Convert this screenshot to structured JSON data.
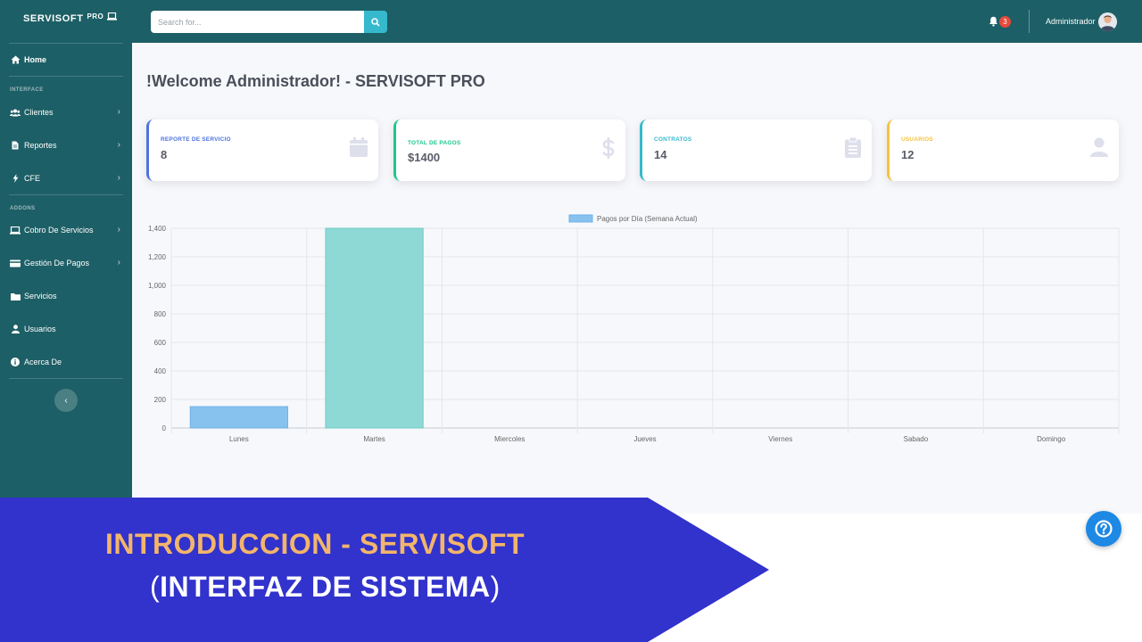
{
  "brand": {
    "name": "SERVISOFT",
    "suffix": "PRO"
  },
  "search": {
    "placeholder": "Search for..."
  },
  "topbar": {
    "notification_count": "3",
    "user_name": "Administrador"
  },
  "sidebar": {
    "home_label": "Home",
    "heading_interface": "INTERFACE",
    "heading_addons": "ADDONS",
    "items": [
      {
        "label": "Clientes",
        "icon": "users-icon"
      },
      {
        "label": "Reportes",
        "icon": "file-icon"
      },
      {
        "label": "CFE",
        "icon": "bolt-icon"
      },
      {
        "label": "Cobro De Servicios",
        "icon": "laptop-icon"
      },
      {
        "label": "Gestión De Pagos",
        "icon": "credit-card-icon"
      },
      {
        "label": "Servicios",
        "icon": "folder-icon"
      },
      {
        "label": "Usuarios",
        "icon": "user-icon"
      },
      {
        "label": "Acerca De",
        "icon": "info-icon"
      }
    ],
    "toggle_glyph": "‹"
  },
  "main": {
    "title": "!Welcome Administrador! - SERVISOFT PRO",
    "cards": [
      {
        "title": "REPORTE DE SERVICIO",
        "value": "8",
        "color": "#4e73df",
        "icon": "calendar-icon"
      },
      {
        "title": "TOTAL DE PAGOS",
        "value": "$1400",
        "color": "#1cc88a",
        "icon": "dollar-icon"
      },
      {
        "title": "CONTRATOS",
        "value": "14",
        "color": "#36b9cc",
        "icon": "clipboard-icon"
      },
      {
        "title": "USUARIOS",
        "value": "12",
        "color": "#f6c23e",
        "icon": "user-icon"
      }
    ]
  },
  "chart_data": {
    "type": "bar",
    "categories": [
      "Lunes",
      "Martes",
      "Miercoles",
      "Jueves",
      "Viernes",
      "Sabado",
      "Domingo"
    ],
    "series": [
      {
        "name": "Pagos por Día (Semana Actual)",
        "values": [
          150,
          1400,
          0,
          0,
          0,
          0,
          0
        ]
      }
    ],
    "bar_colors": [
      "#87c2ee",
      "#8ed9d6",
      "#87c2ee",
      "#87c2ee",
      "#87c2ee",
      "#87c2ee",
      "#87c2ee"
    ],
    "ylim": [
      0,
      1400
    ],
    "yticks": [
      "0",
      "200",
      "400",
      "600",
      "800",
      "1,000",
      "1,200",
      "1,400"
    ],
    "legend_position": "top-center",
    "grid": true
  },
  "banner": {
    "line1": "INTRODUCCION - SERVISOFT",
    "line2_open": "(",
    "line2": "INTERFAZ DE SISTEMA",
    "line2_close": ")",
    "color": "#3232cc"
  },
  "help": {
    "icon": "question-icon"
  }
}
